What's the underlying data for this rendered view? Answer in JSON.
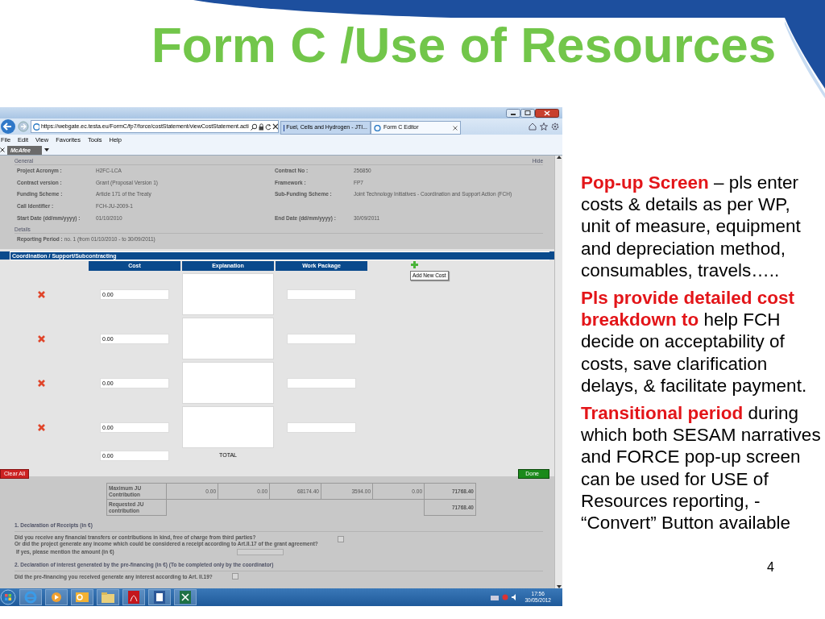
{
  "slide": {
    "title": "Form C /Use of Resources",
    "page_number": "4",
    "bullets": [
      "**Pop-up Screen** – pls enter costs & details as per  WP, unit of measure, equipment and depreciation method, consumables, travels…..",
      "**Pls provide detailed cost breakdown to** help FCH decide on acceptability of costs, save clarification delays, & facilitate payment.",
      "**Transitional period** during which both SESAM narratives and FORCE pop-up screen can be used for USE of Resources reporting,  - “Convert”  Button available"
    ]
  },
  "browser": {
    "address": "https://webgate.ec.testa.eu/FormC/fp7/force/costStatement/viewCostStatement.acti",
    "tabs": [
      {
        "label": "Fuel, Cells and Hydrogen - JTI...",
        "selected": false
      },
      {
        "label": "Form C Editor",
        "selected": true
      }
    ],
    "menu": [
      "File",
      "Edit",
      "View",
      "Favorites",
      "Tools",
      "Help"
    ],
    "addon": "McAfee"
  },
  "general": {
    "title": "General",
    "hide": "Hide",
    "rows": [
      {
        "left": {
          "label": "Project Acronym :",
          "value": "H2FC-LCA"
        },
        "right": {
          "label": "Contract No :",
          "value": "256850"
        }
      },
      {
        "left": {
          "label": "Contract version :",
          "value": "Grant (Proposal Version 1)"
        },
        "right": {
          "label": "Framework :",
          "value": "FP7"
        }
      },
      {
        "left": {
          "label": "Funding Scheme :",
          "value": "Article 171 of the Treaty"
        },
        "right": {
          "label": "Sub-Funding Scheme :",
          "value": "Joint Technology Initiatives - Coordination and Support Action (FCH)"
        }
      },
      {
        "left": {
          "label": "Call Identifier :",
          "value": "FCH-JU-2009-1"
        }
      },
      {
        "left": {
          "label": "Start Date (dd/mm/yyyy) :",
          "value": "01/10/2010"
        },
        "right": {
          "label": "End Date (dd/mm/yyyy) :",
          "value": "30/09/2011"
        }
      }
    ],
    "details_title": "Details",
    "period_label": "Reporting Period :",
    "period_value": "no. 1 (from 01/10/2010 - to 30/09/2011)"
  },
  "popup": {
    "title": "Coordination / Support/Subcontracting",
    "columns": [
      "Cost",
      "Explanation",
      "Work Package"
    ],
    "tooltip": "Add New Cost",
    "rows": [
      {
        "cost": "0.00"
      },
      {
        "cost": "0.00"
      },
      {
        "cost": "0.00"
      },
      {
        "cost": "0.00"
      }
    ],
    "total": "0.00",
    "total_label": "TOTAL",
    "clear_button": "Clear All",
    "done_button": "Done"
  },
  "summary": [
    {
      "label": "Maximum JU Contribution",
      "values": [
        "0.00",
        "0.00",
        "68174.40",
        "3594.00",
        "0.00"
      ],
      "total": "71768.40"
    },
    {
      "label": "Requested JU contribution",
      "total": "71768.40"
    }
  ],
  "declarations": [
    {
      "heading": "1.  Declaration of Receipts (in €)",
      "question": "Did you receive any financial transfers or contributions in kind, free of charge from third parties?\nOr did the project generate any income which could be considered a receipt according to Art.II.17 of the grant agreement?",
      "checked": false,
      "amount_label": "If yes, please mention the amount (in €)"
    },
    {
      "heading": "2.  Declaration of interest generated by the pre-financing (in €) (To be completed only by the coordinator)",
      "question": "Did the pre-financing you received generate any interest according to Art. II.19?",
      "checked": false
    }
  ],
  "taskbar": {
    "time": "17:56",
    "date": "30/05/2012"
  }
}
